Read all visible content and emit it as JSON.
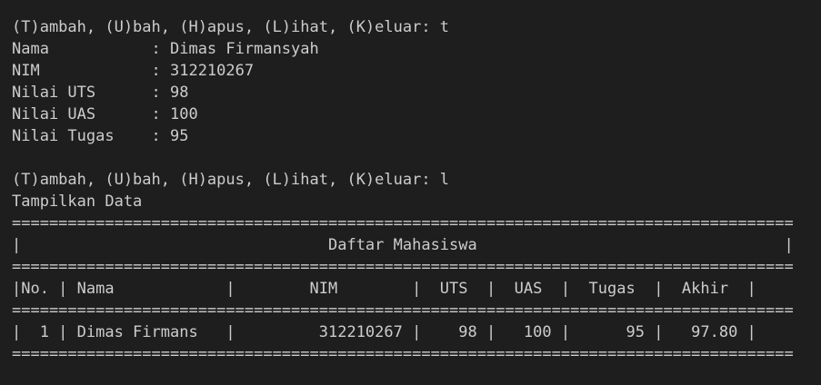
{
  "terminal": {
    "input_block_1": {
      "prompt": "(T)ambah, (U)bah, (H)apus, (L)ihat, (K)eluar: t",
      "fields": [
        "Nama           : Dimas Firmansyah",
        "NIM            : 312210267",
        "Nilai UTS      : 98",
        "Nilai UAS      : 100",
        "Nilai Tugas    : 95"
      ]
    },
    "input_block_2": {
      "prompt": "(T)ambah, (U)bah, (H)apus, (L)ihat, (K)eluar: l",
      "response": "Tampilkan Data"
    },
    "table": {
      "separator": "====================================================================================",
      "title_line": "|                                 Daftar Mahasiswa                                 |",
      "header_line": "|No. | Nama            |        NIM        |  UTS  |  UAS  |  Tugas  |  Akhir  |",
      "rows": [
        "|  1 | Dimas Firmans   |         312210267 |    98 |   100 |      95 |   97.80 |"
      ]
    }
  },
  "colors": {
    "background": "#1e1e1e",
    "text": "#cccccc"
  }
}
